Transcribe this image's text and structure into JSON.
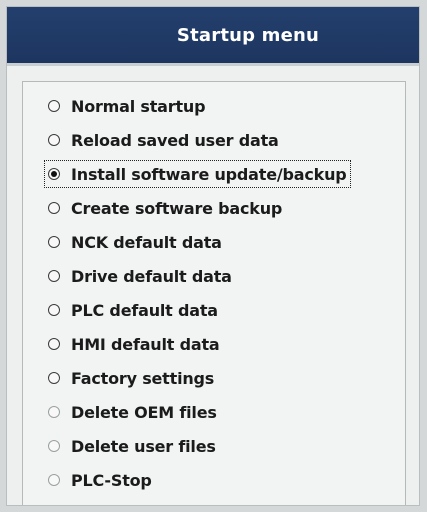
{
  "window": {
    "title": "Startup menu"
  },
  "options": [
    {
      "label": "Normal startup",
      "selected": false
    },
    {
      "label": "Reload saved user data",
      "selected": false
    },
    {
      "label": "Install software update/backup",
      "selected": true
    },
    {
      "label": "Create software backup",
      "selected": false
    },
    {
      "label": "NCK default data",
      "selected": false
    },
    {
      "label": "Drive default data",
      "selected": false
    },
    {
      "label": "PLC default data",
      "selected": false
    },
    {
      "label": "HMI default data",
      "selected": false
    },
    {
      "label": "Factory settings",
      "selected": false
    },
    {
      "label": "Delete OEM files",
      "selected": false
    },
    {
      "label": "Delete user files",
      "selected": false
    },
    {
      "label": "PLC-Stop",
      "selected": false
    }
  ],
  "colors": {
    "title_bar": "#1d3660",
    "title_text": "#ffffff",
    "panel": "#f2f4f4",
    "text": "#1b1b1b"
  }
}
